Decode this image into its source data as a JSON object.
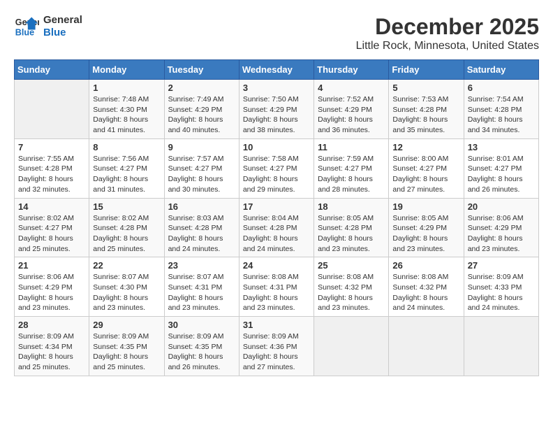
{
  "logo": {
    "line1": "General",
    "line2": "Blue"
  },
  "title": "December 2025",
  "subtitle": "Little Rock, Minnesota, United States",
  "weekdays": [
    "Sunday",
    "Monday",
    "Tuesday",
    "Wednesday",
    "Thursday",
    "Friday",
    "Saturday"
  ],
  "weeks": [
    [
      {
        "day": "",
        "info": ""
      },
      {
        "day": "1",
        "info": "Sunrise: 7:48 AM\nSunset: 4:30 PM\nDaylight: 8 hours\nand 41 minutes."
      },
      {
        "day": "2",
        "info": "Sunrise: 7:49 AM\nSunset: 4:29 PM\nDaylight: 8 hours\nand 40 minutes."
      },
      {
        "day": "3",
        "info": "Sunrise: 7:50 AM\nSunset: 4:29 PM\nDaylight: 8 hours\nand 38 minutes."
      },
      {
        "day": "4",
        "info": "Sunrise: 7:52 AM\nSunset: 4:29 PM\nDaylight: 8 hours\nand 36 minutes."
      },
      {
        "day": "5",
        "info": "Sunrise: 7:53 AM\nSunset: 4:28 PM\nDaylight: 8 hours\nand 35 minutes."
      },
      {
        "day": "6",
        "info": "Sunrise: 7:54 AM\nSunset: 4:28 PM\nDaylight: 8 hours\nand 34 minutes."
      }
    ],
    [
      {
        "day": "7",
        "info": "Sunrise: 7:55 AM\nSunset: 4:28 PM\nDaylight: 8 hours\nand 32 minutes."
      },
      {
        "day": "8",
        "info": "Sunrise: 7:56 AM\nSunset: 4:27 PM\nDaylight: 8 hours\nand 31 minutes."
      },
      {
        "day": "9",
        "info": "Sunrise: 7:57 AM\nSunset: 4:27 PM\nDaylight: 8 hours\nand 30 minutes."
      },
      {
        "day": "10",
        "info": "Sunrise: 7:58 AM\nSunset: 4:27 PM\nDaylight: 8 hours\nand 29 minutes."
      },
      {
        "day": "11",
        "info": "Sunrise: 7:59 AM\nSunset: 4:27 PM\nDaylight: 8 hours\nand 28 minutes."
      },
      {
        "day": "12",
        "info": "Sunrise: 8:00 AM\nSunset: 4:27 PM\nDaylight: 8 hours\nand 27 minutes."
      },
      {
        "day": "13",
        "info": "Sunrise: 8:01 AM\nSunset: 4:27 PM\nDaylight: 8 hours\nand 26 minutes."
      }
    ],
    [
      {
        "day": "14",
        "info": "Sunrise: 8:02 AM\nSunset: 4:27 PM\nDaylight: 8 hours\nand 25 minutes."
      },
      {
        "day": "15",
        "info": "Sunrise: 8:02 AM\nSunset: 4:28 PM\nDaylight: 8 hours\nand 25 minutes."
      },
      {
        "day": "16",
        "info": "Sunrise: 8:03 AM\nSunset: 4:28 PM\nDaylight: 8 hours\nand 24 minutes."
      },
      {
        "day": "17",
        "info": "Sunrise: 8:04 AM\nSunset: 4:28 PM\nDaylight: 8 hours\nand 24 minutes."
      },
      {
        "day": "18",
        "info": "Sunrise: 8:05 AM\nSunset: 4:28 PM\nDaylight: 8 hours\nand 23 minutes."
      },
      {
        "day": "19",
        "info": "Sunrise: 8:05 AM\nSunset: 4:29 PM\nDaylight: 8 hours\nand 23 minutes."
      },
      {
        "day": "20",
        "info": "Sunrise: 8:06 AM\nSunset: 4:29 PM\nDaylight: 8 hours\nand 23 minutes."
      }
    ],
    [
      {
        "day": "21",
        "info": "Sunrise: 8:06 AM\nSunset: 4:29 PM\nDaylight: 8 hours\nand 23 minutes."
      },
      {
        "day": "22",
        "info": "Sunrise: 8:07 AM\nSunset: 4:30 PM\nDaylight: 8 hours\nand 23 minutes."
      },
      {
        "day": "23",
        "info": "Sunrise: 8:07 AM\nSunset: 4:31 PM\nDaylight: 8 hours\nand 23 minutes."
      },
      {
        "day": "24",
        "info": "Sunrise: 8:08 AM\nSunset: 4:31 PM\nDaylight: 8 hours\nand 23 minutes."
      },
      {
        "day": "25",
        "info": "Sunrise: 8:08 AM\nSunset: 4:32 PM\nDaylight: 8 hours\nand 23 minutes."
      },
      {
        "day": "26",
        "info": "Sunrise: 8:08 AM\nSunset: 4:32 PM\nDaylight: 8 hours\nand 24 minutes."
      },
      {
        "day": "27",
        "info": "Sunrise: 8:09 AM\nSunset: 4:33 PM\nDaylight: 8 hours\nand 24 minutes."
      }
    ],
    [
      {
        "day": "28",
        "info": "Sunrise: 8:09 AM\nSunset: 4:34 PM\nDaylight: 8 hours\nand 25 minutes."
      },
      {
        "day": "29",
        "info": "Sunrise: 8:09 AM\nSunset: 4:35 PM\nDaylight: 8 hours\nand 25 minutes."
      },
      {
        "day": "30",
        "info": "Sunrise: 8:09 AM\nSunset: 4:35 PM\nDaylight: 8 hours\nand 26 minutes."
      },
      {
        "day": "31",
        "info": "Sunrise: 8:09 AM\nSunset: 4:36 PM\nDaylight: 8 hours\nand 27 minutes."
      },
      {
        "day": "",
        "info": ""
      },
      {
        "day": "",
        "info": ""
      },
      {
        "day": "",
        "info": ""
      }
    ]
  ]
}
